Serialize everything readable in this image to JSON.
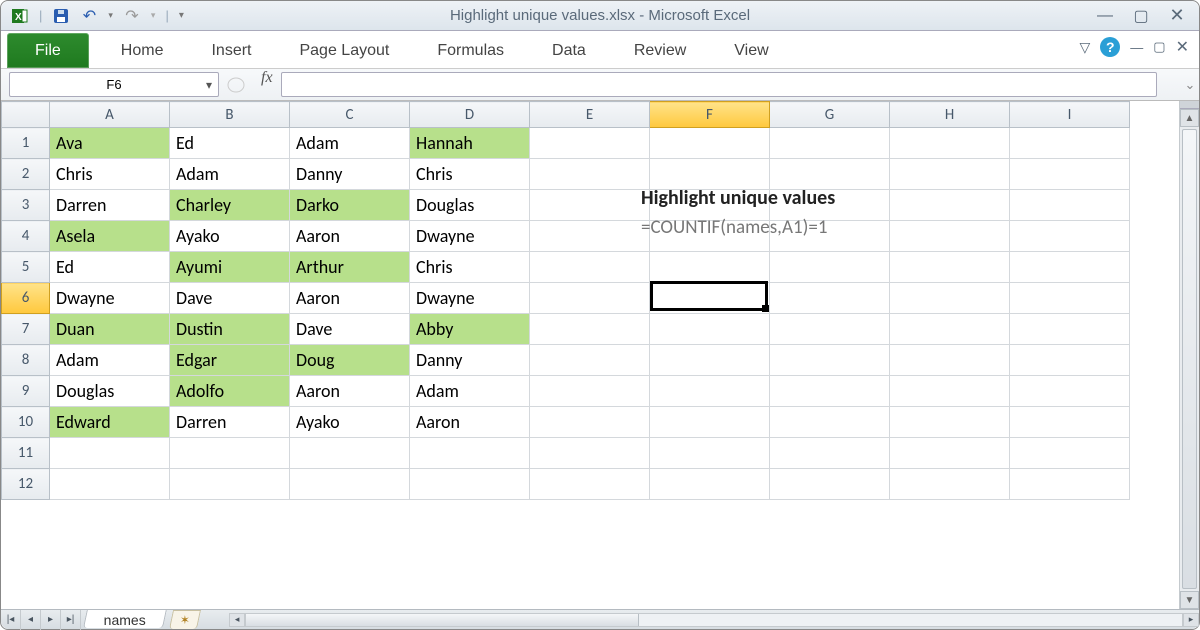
{
  "window": {
    "title": "Highlight unique values.xlsx  -  Microsoft Excel"
  },
  "ribbon": {
    "file_label": "File",
    "tabs": [
      "Home",
      "Insert",
      "Page Layout",
      "Formulas",
      "Data",
      "Review",
      "View"
    ]
  },
  "name_box": "F6",
  "fx_label": "fx",
  "formula_value": "",
  "columns": [
    "A",
    "B",
    "C",
    "D",
    "E",
    "F",
    "G",
    "H",
    "I"
  ],
  "active_col": "F",
  "active_row": 6,
  "rows": [
    1,
    2,
    3,
    4,
    5,
    6,
    7,
    8,
    9,
    10,
    11,
    12
  ],
  "cells": {
    "A1": "Ava",
    "B1": "Ed",
    "C1": "Adam",
    "D1": "Hannah",
    "A2": "Chris",
    "B2": "Adam",
    "C2": "Danny",
    "D2": "Chris",
    "A3": "Darren",
    "B3": "Charley",
    "C3": "Darko",
    "D3": "Douglas",
    "A4": "Asela",
    "B4": "Ayako",
    "C4": "Aaron",
    "D4": "Dwayne",
    "A5": "Ed",
    "B5": "Ayumi",
    "C5": "Arthur",
    "D5": "Chris",
    "A6": "Dwayne",
    "B6": "Dave",
    "C6": "Aaron",
    "D6": "Dwayne",
    "A7": "Duan",
    "B7": "Dustin",
    "C7": "Dave",
    "D7": "Abby",
    "A8": "Adam",
    "B8": "Edgar",
    "C8": "Doug",
    "D8": "Danny",
    "A9": "Douglas",
    "B9": "Adolfo",
    "C9": "Aaron",
    "D9": "Adam",
    "A10": "Edward",
    "B10": "Darren",
    "C10": "Ayako",
    "D10": "Aaron"
  },
  "highlighted": [
    "A1",
    "D1",
    "B3",
    "C3",
    "A4",
    "B5",
    "C5",
    "A7",
    "B7",
    "D7",
    "B8",
    "C8",
    "B9",
    "A10"
  ],
  "overlay": {
    "title": "Highlight unique values",
    "formula": "=COUNTIF(names,A1)=1"
  },
  "sheet_tab": "names"
}
